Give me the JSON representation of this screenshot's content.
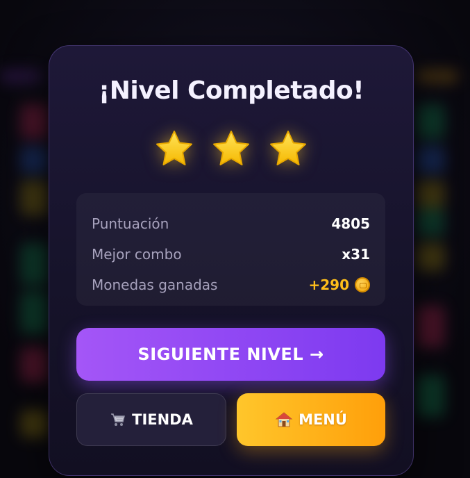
{
  "dialog": {
    "title": "¡Nivel Completado!",
    "stars_earned": 3,
    "stars_total": 3
  },
  "stats": [
    {
      "label": "Puntuación",
      "value": "4805"
    },
    {
      "label": "Mejor combo",
      "value": "x31"
    },
    {
      "label": "Monedas ganadas",
      "value": "+290",
      "icon": "coin-icon"
    }
  ],
  "buttons": {
    "next_label": "SIGUIENTE NIVEL →",
    "shop_label": "TIENDA",
    "shop_icon": "cart-icon",
    "menu_label": "MENÚ",
    "menu_icon": "house-icon"
  },
  "colors": {
    "primary": "#8b45f3",
    "gold": "#ffbf1a",
    "card": "#1a1530"
  }
}
